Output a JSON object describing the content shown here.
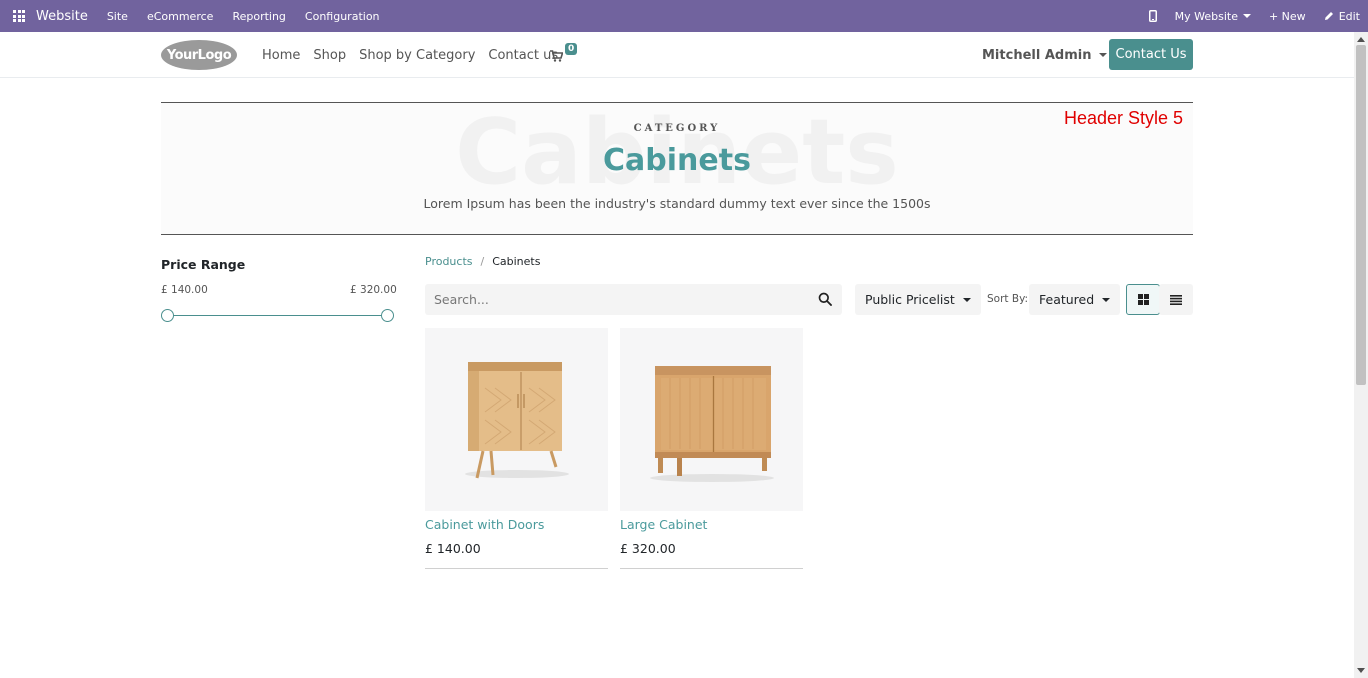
{
  "admin_bar": {
    "brand": "Website",
    "menu": [
      "Site",
      "eCommerce",
      "Reporting",
      "Configuration"
    ],
    "my_website": "My Website",
    "new": "+ New",
    "edit": "Edit",
    "background": "#71639e"
  },
  "header": {
    "logo": "YourLogo",
    "nav": [
      "Home",
      "Shop",
      "Shop by Category",
      "Contact us"
    ],
    "cart_count": "0",
    "user": "Mitchell Admin",
    "contact_button": "Contact Us",
    "accent": "#4a8f8e"
  },
  "banner": {
    "background_text": "Cabinets",
    "eyebrow": "CATEGORY",
    "title": "Cabinets",
    "description": "Lorem Ipsum has been the industry's standard dummy text ever since the 1500s",
    "annotation": "Header Style 5"
  },
  "filter": {
    "title": "Price Range",
    "min": "£ 140.00",
    "max": "£ 320.00",
    "selected_fraction": [
      0.0,
      1.0
    ]
  },
  "breadcrumb": {
    "parent": "Products",
    "separator": "/",
    "current": "Cabinets"
  },
  "toolbar": {
    "search_placeholder": "Search...",
    "pricelist": "Public Pricelist",
    "sort_label": "Sort By:",
    "sort_value": "Featured",
    "active_view": "grid"
  },
  "products": [
    {
      "name": "Cabinet with Doors",
      "price": "£ 140.00",
      "image": "cabinet-with-doors"
    },
    {
      "name": "Large Cabinet",
      "price": "£ 320.00",
      "image": "large-cabinet"
    }
  ]
}
